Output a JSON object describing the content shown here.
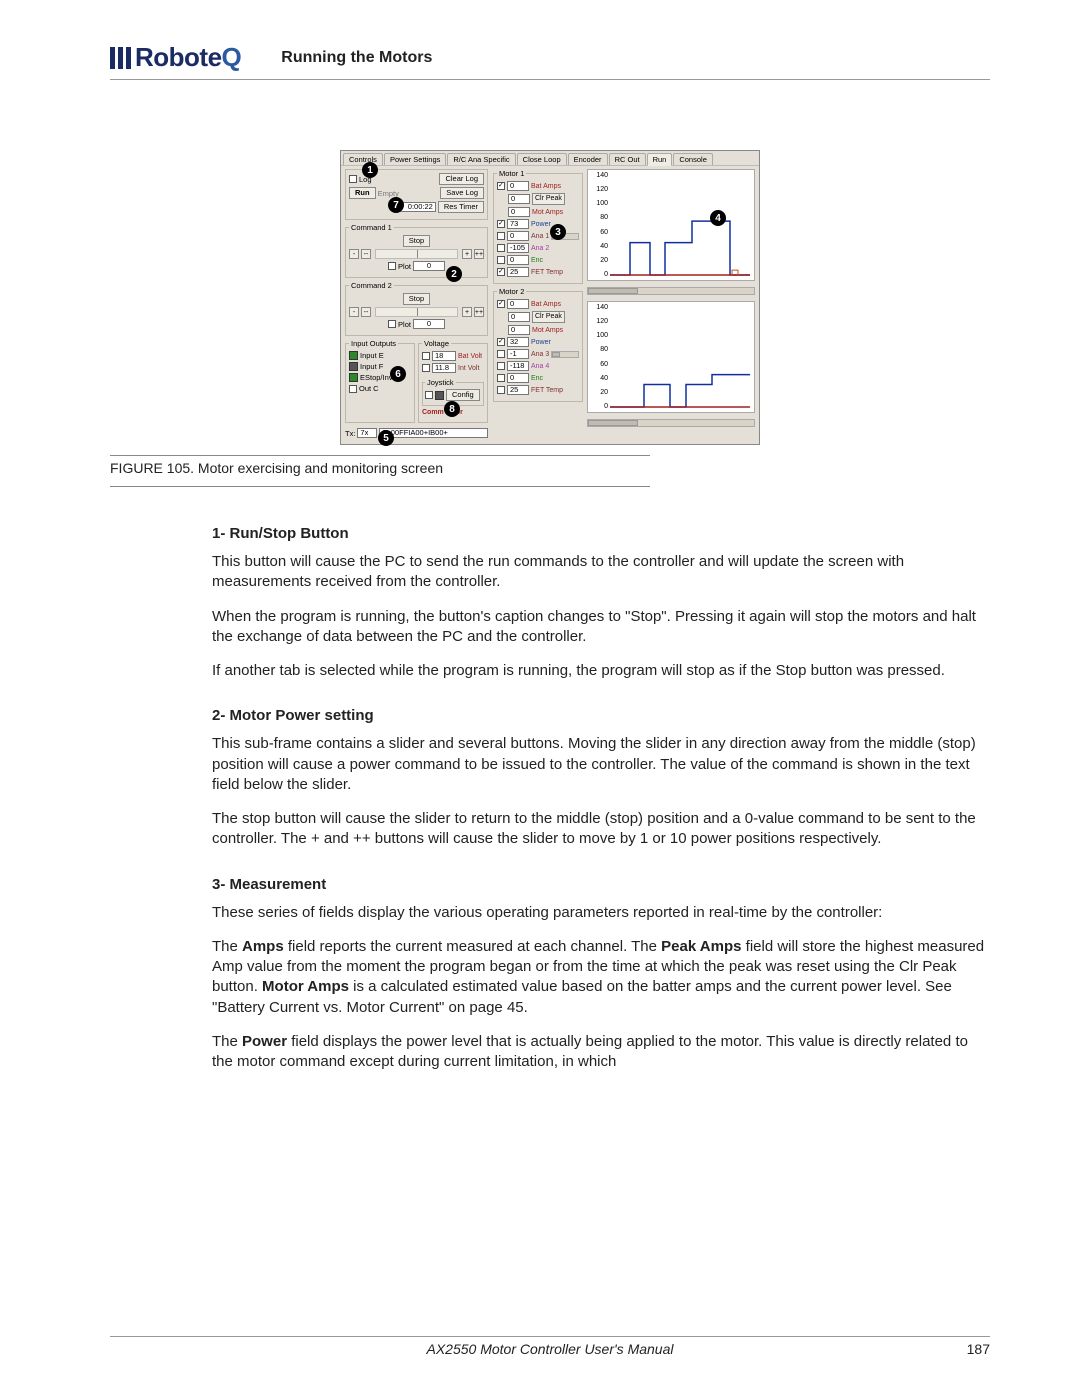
{
  "header": {
    "brand_prefix": "Robote",
    "brand_q": "Q",
    "title": "Running the Motors"
  },
  "figure": {
    "label": "FIGURE 105.  Motor exercising and monitoring screen"
  },
  "tabs": [
    "Controls",
    "Power Settings",
    "R/C Ana Specific",
    "Close Loop",
    "Encoder",
    "RC Out",
    "Run",
    "Console"
  ],
  "runbox": {
    "log": "Log",
    "clear": "Clear Log",
    "run": "Run",
    "empty": "Empty",
    "save": "Save Log",
    "timer": "0:00:22",
    "reset": "Res Timer"
  },
  "command": {
    "title1": "Command 1",
    "title2": "Command 2",
    "stop": "Stop",
    "plot": "Plot",
    "zero": "0"
  },
  "io": {
    "title": "Input Outputs",
    "inE": "Input E",
    "inF": "Input F",
    "estop": "EStop/Inv",
    "outC": "Out C"
  },
  "volt": {
    "title": "Voltage",
    "batv": "Bat Volt",
    "intv": "Int Volt",
    "v1": "18",
    "v2": "11.8",
    "joy": "Joystick",
    "config": "Config",
    "commerr": "Comm Error"
  },
  "tx": {
    "label": "Tx:",
    "port": "7x",
    "data": "?p00FFIA00+IB00+"
  },
  "motor": {
    "m1": "Motor 1",
    "m2": "Motor 2",
    "bat": "Bat Amps",
    "clr": "Clr Peak",
    "mota": "Mot Amps",
    "pow": "Power",
    "ana1": "Ana 1",
    "ana2": "Ana 2",
    "ana3": "Ana 3",
    "ana4": "Ana 4",
    "enc": "Enc",
    "fet": "FET Temp",
    "m1_vals": {
      "bat": "0",
      "peak": "0",
      "mota": "0",
      "pow": "73",
      "ana1": "0",
      "ana2": "-105",
      "enc": "0",
      "fet": "25"
    },
    "m2_vals": {
      "bat": "0",
      "peak": "0",
      "mota": "0",
      "pow": "32",
      "ana1": "-1",
      "ana2": "-118",
      "enc": "0",
      "fet": "25"
    }
  },
  "ylabels": [
    "140",
    "120",
    "100",
    "80",
    "60",
    "40",
    "20",
    "0"
  ],
  "callouts": [
    "1",
    "2",
    "3",
    "4",
    "5",
    "6",
    "7",
    "8"
  ],
  "sections": {
    "s1h": "1- Run/Stop Button",
    "s1a": "This button will cause the PC to send the run commands to the controller and will update the screen with measurements received from the controller.",
    "s1b": "When the program is running, the button's caption changes to \"Stop\". Pressing it again will stop the motors and halt the exchange of data between the PC and the controller.",
    "s1c": "If another tab is selected while the program is running, the program will stop as if the Stop button was pressed.",
    "s2h": "2- Motor Power setting",
    "s2a": "This sub-frame contains a slider and several buttons. Moving the slider in any direction away from the middle (stop) position will cause a power command to be issued to the controller. The value of the command is shown in the text field below the slider.",
    "s2b": "The stop button will cause the slider to return to the middle (stop) position and a 0-value command to be sent to the controller. The + and ++ buttons will cause the slider to move by 1 or 10 power positions respectively.",
    "s3h": "3- Measurement",
    "s3a": "These series of fields display the various operating parameters reported in real-time by the controller:",
    "s3b_pre": "The ",
    "s3b_b1": "Amps",
    "s3b_mid1": " field reports the current measured at each channel. The ",
    "s3b_b2": "Peak Amps",
    "s3b_mid2": " field will store the highest measured Amp value from the moment the program began or from the time at which the peak was reset using the Clr Peak button. ",
    "s3b_b3": "Motor Amps",
    "s3b_end": " is a calculated estimated value based on the batter amps and the current power level. See \"Battery Current vs. Motor Current\" on page 45.",
    "s3c_pre": "The ",
    "s3c_b1": "Power",
    "s3c_end": " field displays the power level that is actually being applied to the motor. This value is directly related to the motor command except during current limitation, in which"
  },
  "footer": {
    "manual": "AX2550 Motor Controller User's Manual",
    "page": "187"
  }
}
